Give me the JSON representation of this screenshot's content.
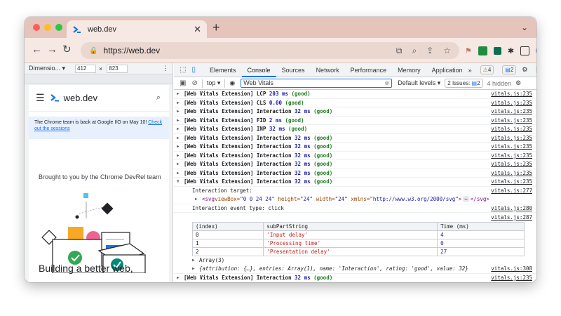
{
  "browser": {
    "tab_title": "web.dev",
    "url": "https://web.dev",
    "accent": "#e4c4bb"
  },
  "device_toolbar": {
    "device": "Dimensio...",
    "width": "412",
    "x": "×",
    "height": "823"
  },
  "site": {
    "logo": "web.dev",
    "banner_text": "The Chrome team is back at Google I/O on May 10! ",
    "banner_link": "Check out the sessions",
    "brought": "Brought to you by the Chrome DevRel team",
    "headline": "Building a better web,"
  },
  "devtools": {
    "tabs": [
      "Elements",
      "Console",
      "Sources",
      "Network",
      "Performance",
      "Memory",
      "Application"
    ],
    "active_tab": "Console",
    "more": "»",
    "warn_count": "4",
    "msg_count": "2",
    "context": "top ▾",
    "filter": "Web Vitals",
    "levels": "Default levels ▾",
    "issues_label": "2 Issues:",
    "issues_count": "2",
    "hidden": "4 hidden"
  },
  "logs": [
    {
      "prefix": "[Web Vitals Extension]",
      "metric": "LCP",
      "value": "203 ms",
      "rating": "(good)",
      "source": "vitals.js:235"
    },
    {
      "prefix": "[Web Vitals Extension]",
      "metric": "CLS",
      "value": "0.00",
      "rating": "(good)",
      "source": "vitals.js:235"
    },
    {
      "prefix": "[Web Vitals Extension]",
      "metric": "Interaction",
      "value": "32 ms",
      "rating": "(good)",
      "source": "vitals.js:235"
    },
    {
      "prefix": "[Web Vitals Extension]",
      "metric": "FID",
      "value": "2 ms",
      "rating": "(good)",
      "source": "vitals.js:235"
    },
    {
      "prefix": "[Web Vitals Extension]",
      "metric": "INP",
      "value": "32 ms",
      "rating": "(good)",
      "source": "vitals.js:235"
    },
    {
      "prefix": "[Web Vitals Extension]",
      "metric": "Interaction",
      "value": "32 ms",
      "rating": "(good)",
      "source": "vitals.js:235"
    },
    {
      "prefix": "[Web Vitals Extension]",
      "metric": "Interaction",
      "value": "32 ms",
      "rating": "(good)",
      "source": "vitals.js:235"
    },
    {
      "prefix": "[Web Vitals Extension]",
      "metric": "Interaction",
      "value": "32 ms",
      "rating": "(good)",
      "source": "vitals.js:235"
    },
    {
      "prefix": "[Web Vitals Extension]",
      "metric": "Interaction",
      "value": "32 ms",
      "rating": "(good)",
      "source": "vitals.js:235"
    },
    {
      "prefix": "[Web Vitals Extension]",
      "metric": "Interaction",
      "value": "32 ms",
      "rating": "(good)",
      "source": "vitals.js:235"
    }
  ],
  "expanded": {
    "prefix": "[Web Vitals Extension]",
    "metric": "Interaction",
    "value": "32 ms",
    "rating": "(good)",
    "source": "vitals.js:235",
    "target_label": "Interaction target:",
    "target_source": "vitals.js:277",
    "svg_open": "<svg",
    "svg_attrs": [
      {
        "name": "viewBox",
        "value": "\"0 0 24 24\""
      },
      {
        "name": "height",
        "value": "\"24\""
      },
      {
        "name": "width",
        "value": "\"24\""
      },
      {
        "name": "xmlns",
        "value": "\"http://www.w3.org/2000/svg\""
      }
    ],
    "svg_ellipsis": "⋯",
    "svg_close": "</svg>",
    "event_type": "Interaction event type: click",
    "event_source": "vitals.js:280",
    "table_source": "vitals.js:287",
    "table_headers": [
      "(index)",
      "subPartString",
      "Time (ms)"
    ],
    "table_rows": [
      [
        "0",
        "'Input delay'",
        "4"
      ],
      [
        "1",
        "'Processing time'",
        "0"
      ],
      [
        "2",
        "'Presentation delay'",
        "27"
      ]
    ],
    "array_label": "Array(3)",
    "object_summary": "{attribution: {…}, entries: Array(1), name: 'Interaction', rating: 'good', value: 32}",
    "object_source": "vitals.js:308"
  },
  "last_log": {
    "prefix": "[Web Vitals Extension]",
    "metric": "Interaction",
    "value": "32 ms",
    "rating": "(good)",
    "source": "vitals.js:235"
  },
  "prompt": "›"
}
